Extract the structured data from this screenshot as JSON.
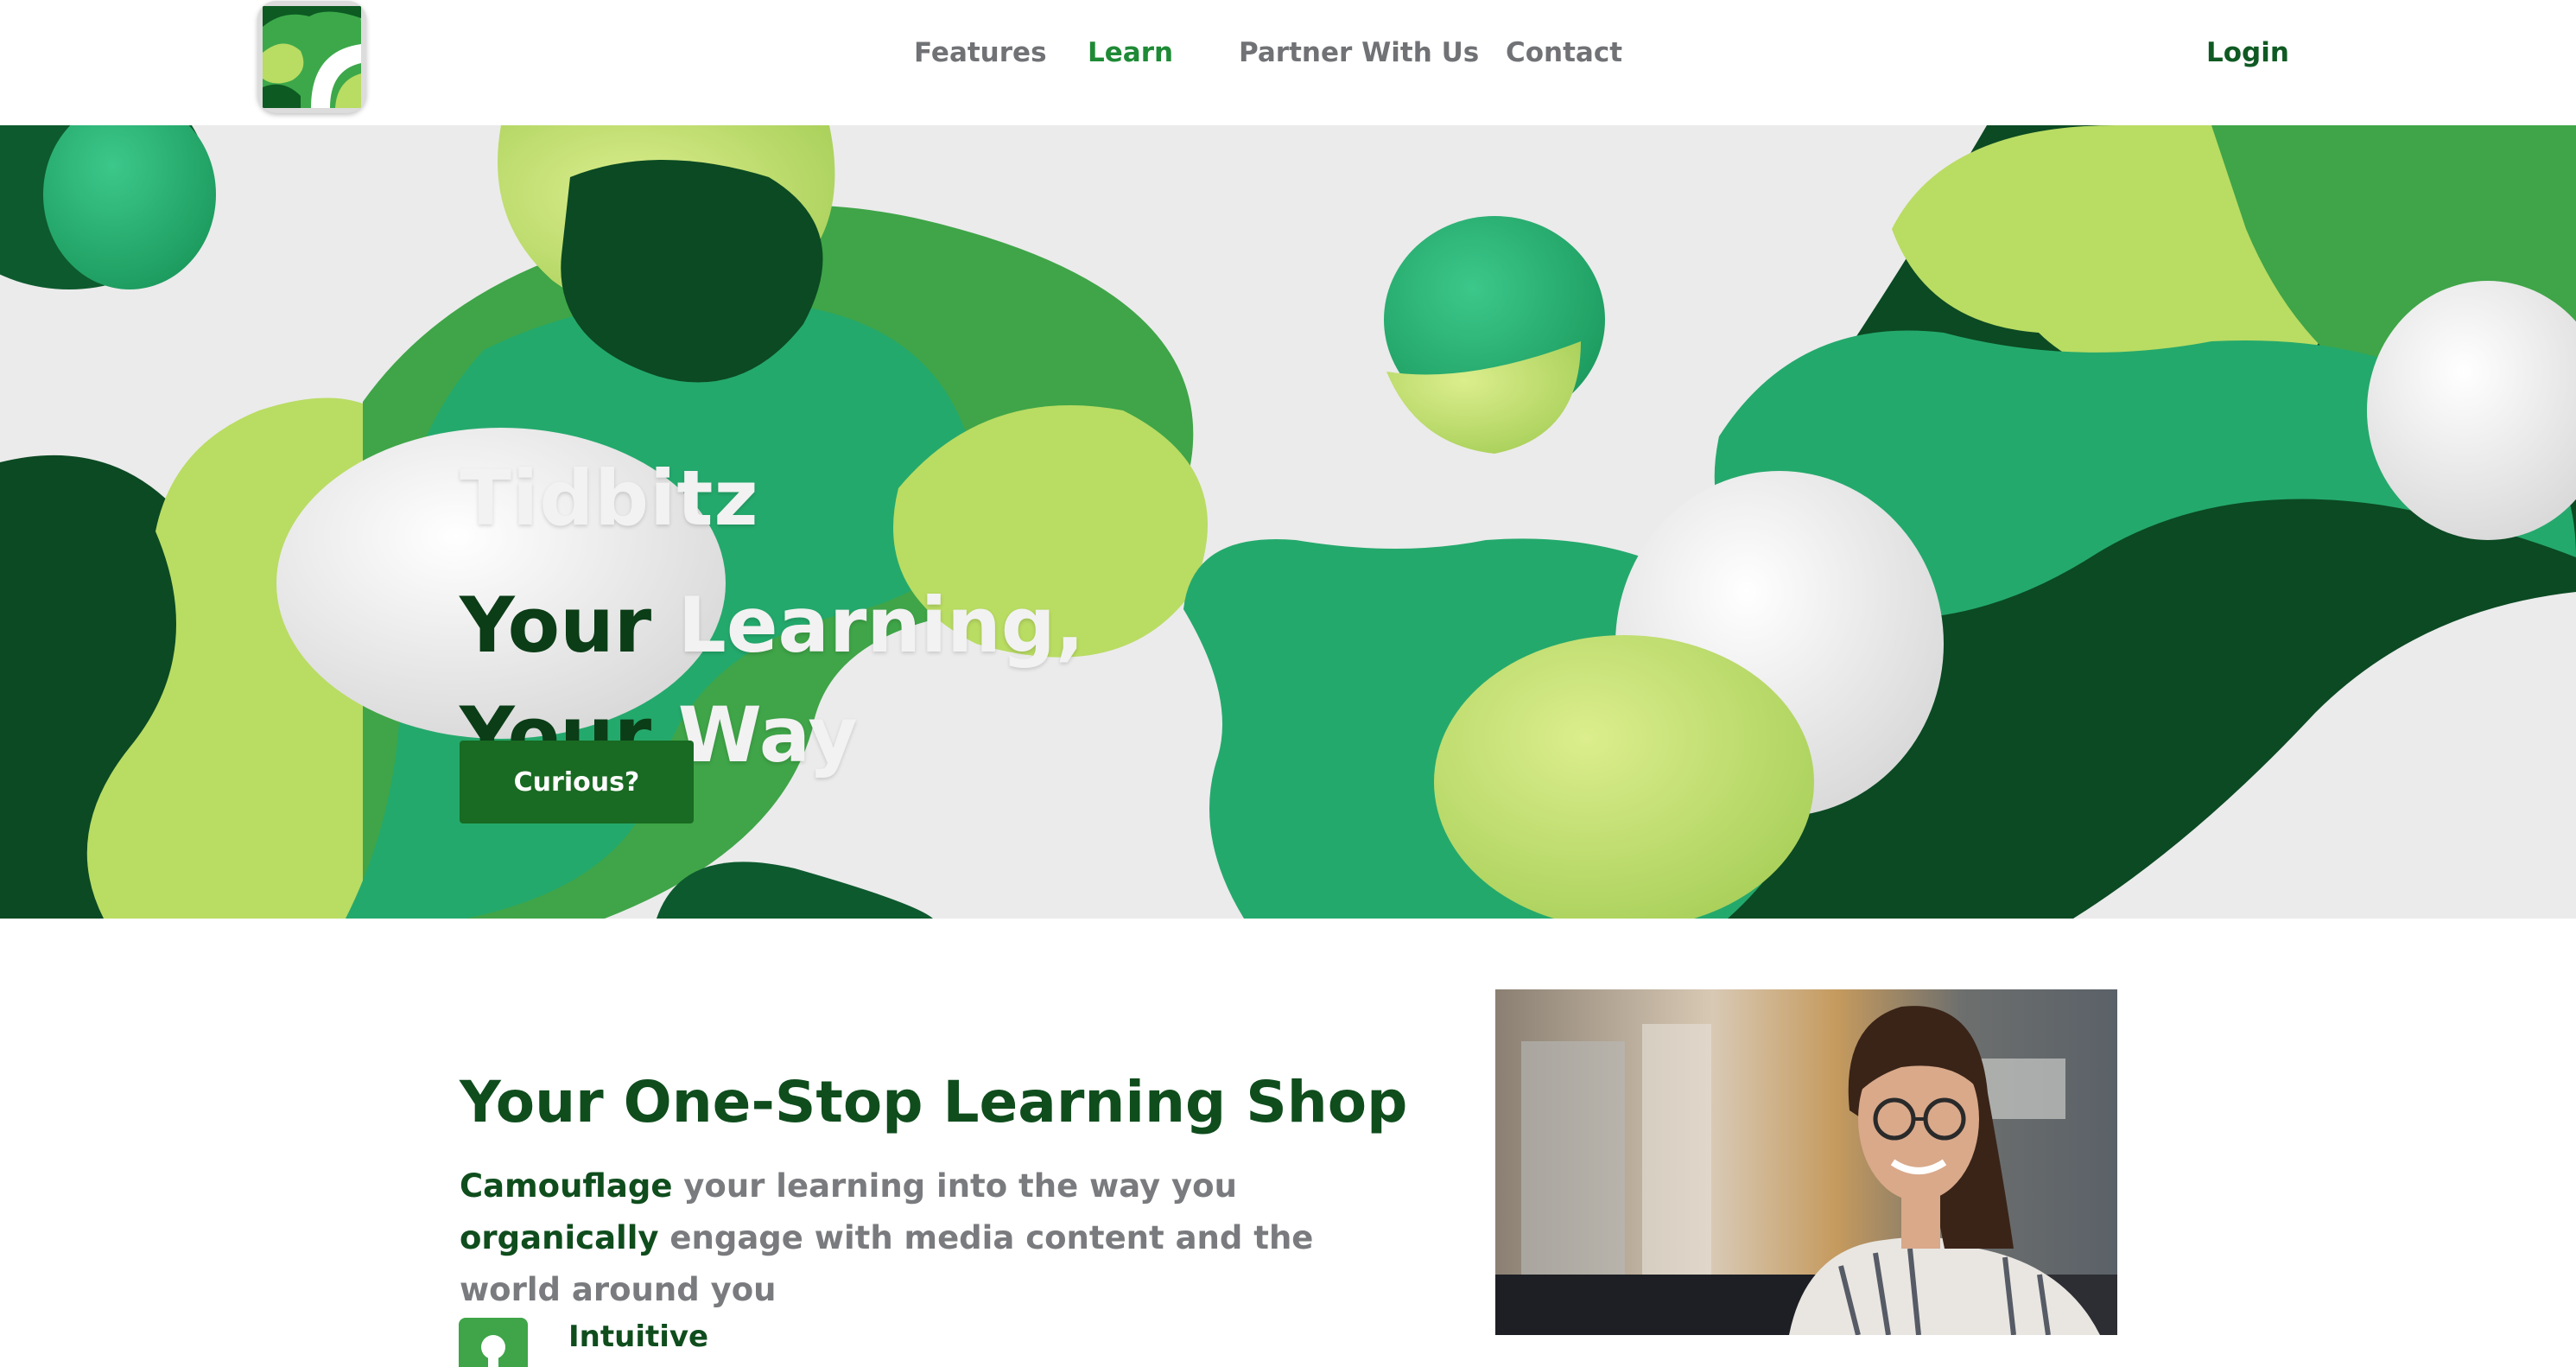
{
  "nav": {
    "logo_icon": "tidbitz-camouflage-logo-icon",
    "links": [
      {
        "label": "Features",
        "active": false
      },
      {
        "label": "Learn",
        "active": true
      },
      {
        "label": "Partner With Us",
        "active": false
      },
      {
        "label": "Contact",
        "active": false
      }
    ],
    "login_label": "Login"
  },
  "hero": {
    "title": "Tidbitz",
    "line1_dark": "Your",
    "line1_light": "Learning,",
    "line2_dark": "Your",
    "line2_light": "Way",
    "cta_label": "Curious?",
    "background": "abstract green and white 3D blob artwork"
  },
  "intro": {
    "heading": "Your One-Stop Learning Shop",
    "desc": {
      "w1": "Camouflage",
      "t1": " your learning into the way you ",
      "w2": "organically",
      "t2": " engage with media content and the world around you"
    },
    "photo": "smiling woman with glasses and earbuds at desk",
    "features": [
      {
        "icon": "lightbulb-icon",
        "label": "Intuitive"
      }
    ]
  },
  "colors": {
    "brand_dark_green": "#0f4d1d",
    "accent_green": "#1e8a35",
    "button_green": "#196a22",
    "nav_gray": "#707275",
    "lime": "#b9dc63",
    "emerald": "#24a96c"
  }
}
